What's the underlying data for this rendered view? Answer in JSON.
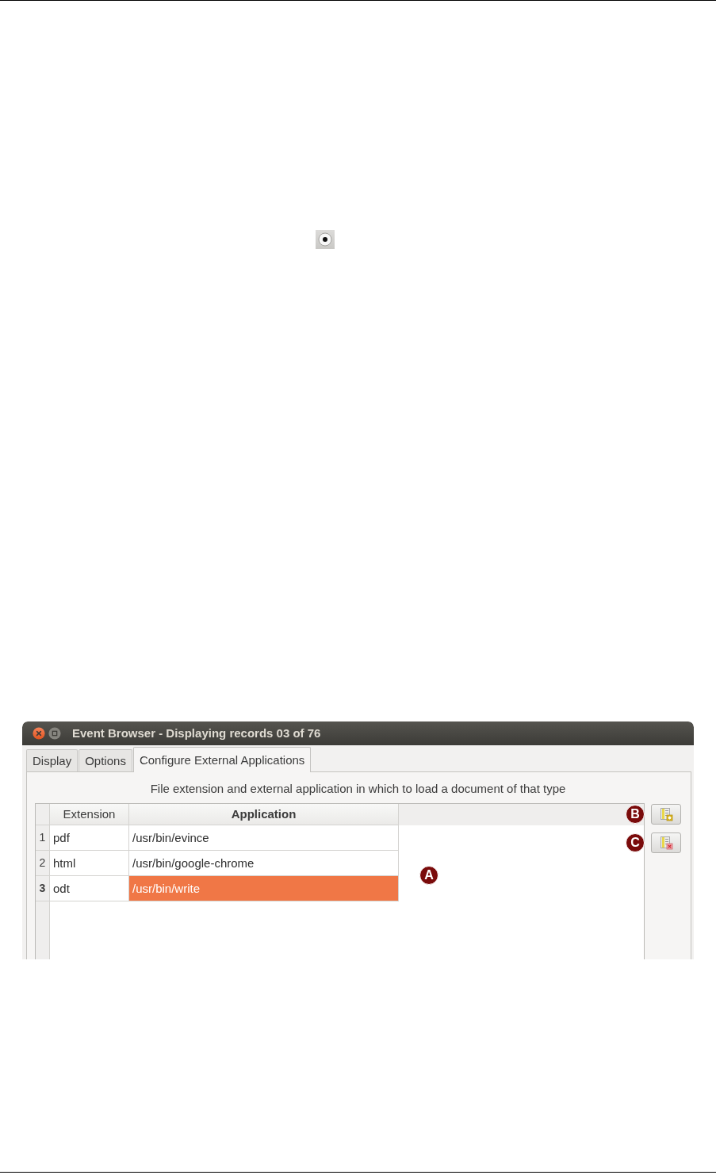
{
  "radio_icon": {
    "checked": true
  },
  "window": {
    "title": "Event Browser - Displaying records 03 of 76",
    "controls": [
      {
        "kind": "close"
      },
      {
        "kind": "maximize"
      }
    ]
  },
  "tabs": [
    {
      "label": "Display",
      "selected": false
    },
    {
      "label": "Options",
      "selected": false
    },
    {
      "label": "Configure External Applications",
      "selected": true
    }
  ],
  "panel": {
    "description": "File extension and external application in which to load a document of that type",
    "table": {
      "callout": "A",
      "columns": [
        {
          "label": "Extension",
          "current": false
        },
        {
          "label": "Application",
          "current": true
        }
      ],
      "rows": [
        {
          "label": "1",
          "current": false,
          "cells": [
            {
              "text": "pdf",
              "selected": false
            },
            {
              "text": "/usr/bin/evince",
              "selected": false
            }
          ]
        },
        {
          "label": "2",
          "current": false,
          "cells": [
            {
              "text": "html",
              "selected": false
            },
            {
              "text": "/usr/bin/google-chrome",
              "selected": false
            }
          ]
        },
        {
          "label": "3",
          "current": true,
          "cells": [
            {
              "text": "odt",
              "selected": false
            },
            {
              "text": "/usr/bin/write",
              "selected": true
            }
          ]
        }
      ]
    },
    "buttons": [
      {
        "kind": "add",
        "callout": "B"
      },
      {
        "kind": "remove",
        "callout": "C"
      }
    ]
  }
}
